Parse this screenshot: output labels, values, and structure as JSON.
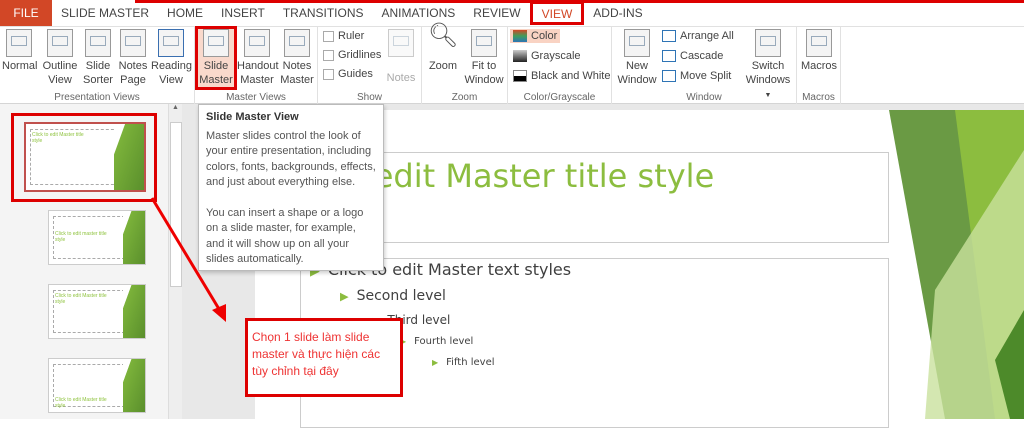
{
  "tabs": [
    "FILE",
    "SLIDE MASTER",
    "HOME",
    "INSERT",
    "TRANSITIONS",
    "ANIMATIONS",
    "REVIEW",
    "VIEW",
    "ADD-INS"
  ],
  "ribbon": {
    "presentation_views": {
      "label": "Presentation Views",
      "buttons": [
        "Normal",
        "Outline View",
        "Slide Sorter",
        "Notes Page",
        "Reading View"
      ]
    },
    "master_views": {
      "label": "Master Views",
      "buttons": [
        "Slide Master",
        "Handout Master",
        "Notes Master"
      ]
    },
    "show": {
      "label": "Show",
      "checks": [
        "Ruler",
        "Gridlines",
        "Guides"
      ],
      "notes": "Notes"
    },
    "zoom": {
      "label": "Zoom",
      "buttons": [
        "Zoom",
        "Fit to Window"
      ]
    },
    "color": {
      "label": "Color/Grayscale",
      "items": [
        "Color",
        "Grayscale",
        "Black and White"
      ]
    },
    "window": {
      "label": "Window",
      "new_window": "New Window",
      "items": [
        "Arrange All",
        "Cascade",
        "Move Split"
      ],
      "switch": "Switch Windows"
    },
    "macros": {
      "label": "Macros",
      "button": "Macros"
    }
  },
  "thumbs": [
    "Click to edit Master title style",
    "Click to edit master title style",
    "Click to edit Master title style",
    "Click to edit Master title style"
  ],
  "tooltip": {
    "title": "Slide Master View",
    "p1": "Master slides control the look of your entire presentation, including colors, fonts, backgrounds, effects, and just about everything else.",
    "p2": "You can insert a shape or a logo on a slide master, for example, and it will show up on all your slides automatically."
  },
  "slide": {
    "title": "Click to edit Master title style",
    "levels": [
      "Click to edit Master text styles",
      "Second level",
      "Third level",
      "Fourth level",
      "Fifth level"
    ]
  },
  "annotation": "Chọn 1 slide làm slide master và thực hiện các tùy chỉnh tại đây"
}
